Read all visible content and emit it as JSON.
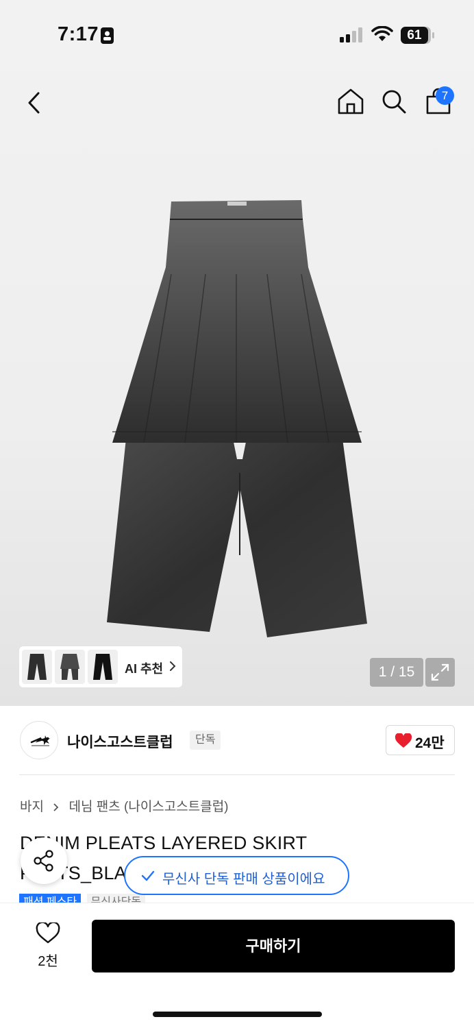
{
  "status_bar": {
    "time": "7:17",
    "battery": "61"
  },
  "nav": {
    "cart_count": "7"
  },
  "gallery": {
    "counter": "1 / 15",
    "ai_label": "AI 추천"
  },
  "brand": {
    "name": "나이스고스트클럽",
    "tag": "단독",
    "likes": "24만"
  },
  "breadcrumb": {
    "category": "바지",
    "subcategory": "데님 팬츠 (나이스고스트클럽)"
  },
  "product": {
    "title": "DENIM PLEATS LAYERED SKIRT PANTS_BLACK(NG2E",
    "tags": [
      "패션 페스타",
      "무신사단독"
    ]
  },
  "toast": {
    "text": "무신사 단독 판매 상품이에요"
  },
  "bottom": {
    "wish_count": "2천",
    "buy_label": "구매하기"
  },
  "colors": {
    "accent": "#1e73ff",
    "like": "#e8202e",
    "buy_bg": "#000000"
  }
}
